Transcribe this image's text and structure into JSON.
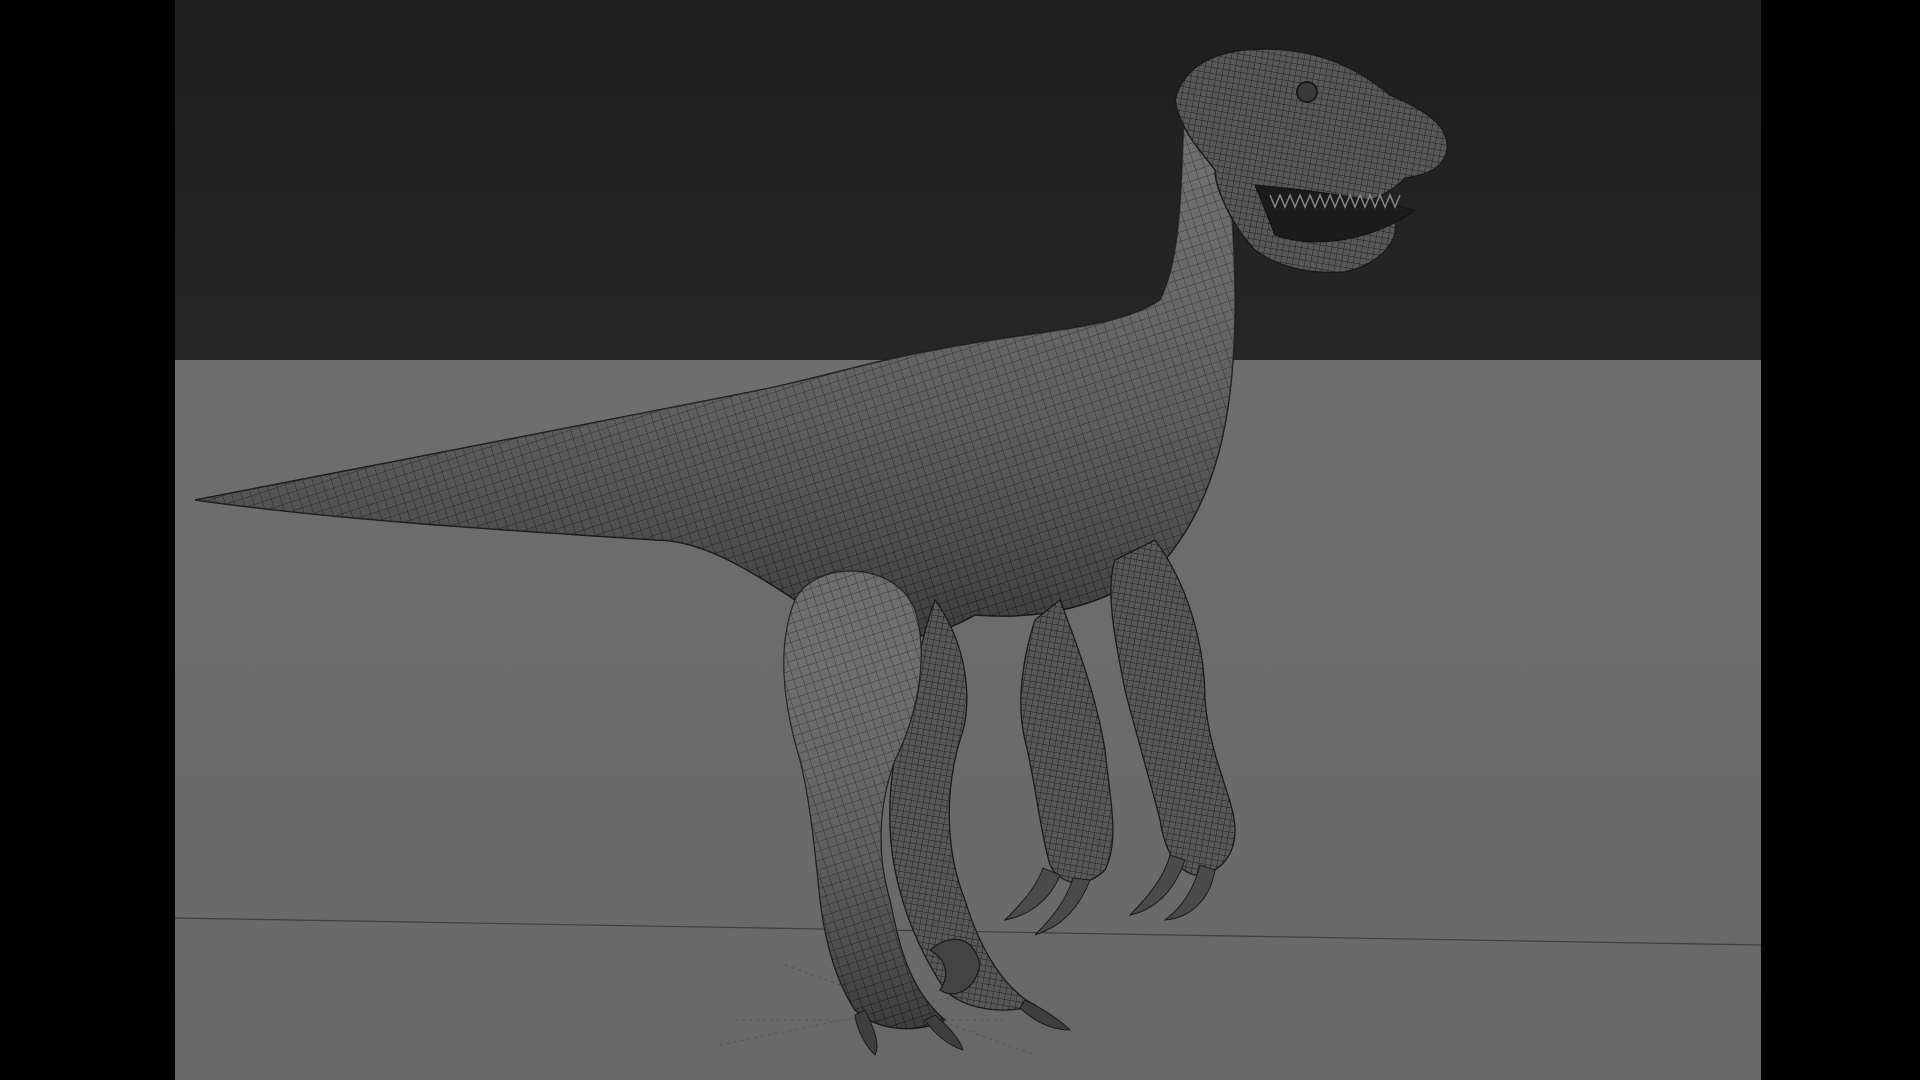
{
  "app": {
    "kind": "3d-modeling-viewport",
    "subject": "raptor-wireframe-model"
  },
  "colors": {
    "letterbox": "#000000",
    "background_top": "#232323",
    "ground": "#6b6b6b",
    "model_base": "#5a5a5a",
    "model_shade": "#3e3e3e",
    "wire": "#1c1c1c",
    "horizon_line": "#3a3a3a"
  },
  "icons": {
    "model": "dinosaur-model-icon",
    "grid": "ground-grid-icon"
  }
}
